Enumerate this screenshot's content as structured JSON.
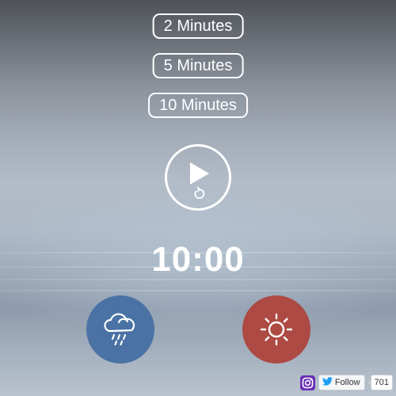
{
  "durations": [
    {
      "label": "2 Minutes"
    },
    {
      "label": "5 Minutes"
    },
    {
      "label": "10 Minutes"
    }
  ],
  "player": {
    "play_icon": "play-icon",
    "replay_icon": "replay-icon"
  },
  "timer": {
    "display": "10:00"
  },
  "sounds": [
    {
      "name": "rain",
      "icon": "cloud-rain-icon",
      "color": "#4a72a4"
    },
    {
      "name": "sun",
      "icon": "sun-icon",
      "color": "#ad4a43"
    }
  ],
  "footer": {
    "instagram_icon": "instagram-icon",
    "twitter_icon": "twitter-bird-icon",
    "follow_label": "Follow",
    "follower_count": "701"
  }
}
